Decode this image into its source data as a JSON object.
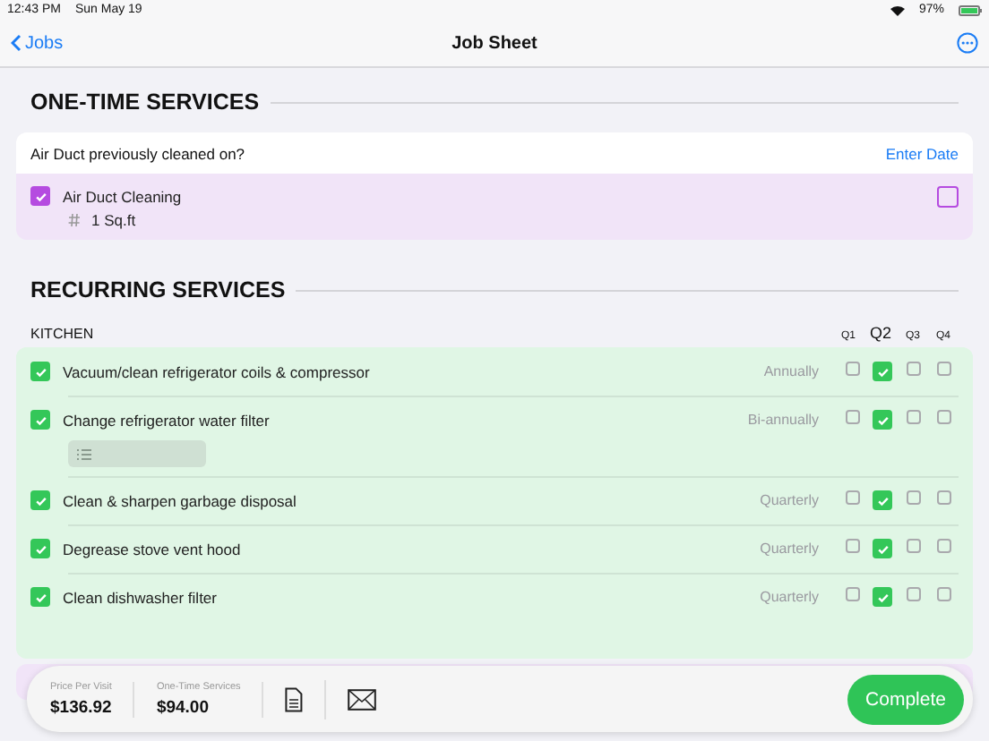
{
  "status_bar": {
    "time": "12:43 PM",
    "date": "Sun May 19",
    "battery": "97%"
  },
  "nav": {
    "back": "Jobs",
    "title": "Job Sheet"
  },
  "one_time": {
    "title": "ONE-TIME SERVICES",
    "question": "Air Duct previously cleaned on?",
    "action": "Enter Date",
    "items": [
      {
        "name": "Air Duct Cleaning",
        "checked": true,
        "quantity": "1 Sq.ft",
        "flagged": false
      }
    ]
  },
  "recurring": {
    "title": "RECURRING SERVICES",
    "groups": [
      {
        "name": "KITCHEN",
        "quarters": [
          {
            "label": "Q1",
            "selected": false
          },
          {
            "label": "Q2",
            "selected": true
          },
          {
            "label": "Q3",
            "selected": false
          },
          {
            "label": "Q4",
            "selected": false
          }
        ],
        "items": [
          {
            "name": "Vacuum/clean refrigerator coils & compressor",
            "checked": true,
            "frequency": "Annually",
            "quarters": [
              false,
              true,
              false,
              false
            ],
            "notes": false
          },
          {
            "name": "Change refrigerator water filter",
            "checked": true,
            "frequency": "Bi-annually",
            "quarters": [
              false,
              true,
              false,
              false
            ],
            "notes": true
          },
          {
            "name": "Clean & sharpen garbage disposal",
            "checked": true,
            "frequency": "Quarterly",
            "quarters": [
              false,
              true,
              false,
              false
            ],
            "notes": false
          },
          {
            "name": "Degrease stove vent hood",
            "checked": true,
            "frequency": "Quarterly",
            "quarters": [
              false,
              true,
              false,
              false
            ],
            "notes": false
          },
          {
            "name": "Clean dishwasher filter",
            "checked": true,
            "frequency": "Quarterly",
            "quarters": [
              false,
              true,
              false,
              false
            ],
            "notes": false
          }
        ]
      }
    ]
  },
  "summary": {
    "fields": [
      {
        "label": "Price Per Visit",
        "value": "$136.92"
      },
      {
        "label": "One-Time Services",
        "value": "$94.00"
      }
    ],
    "complete": "Complete"
  }
}
